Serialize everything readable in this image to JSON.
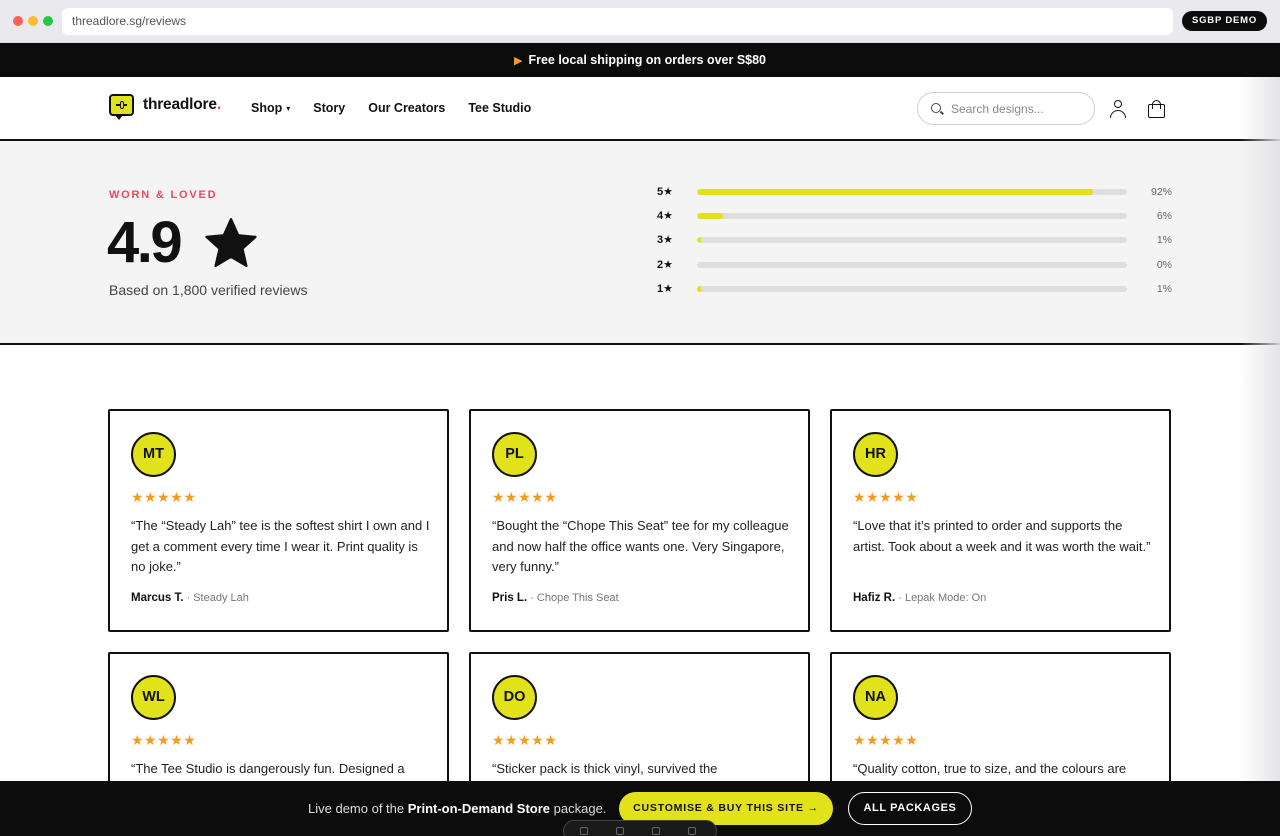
{
  "browser": {
    "url": "threadlore.sg/reviews",
    "badge": "SGBP DEMO"
  },
  "announcement": {
    "text": "Free local shipping on orders over S$80",
    "icon": "truck-icon"
  },
  "header": {
    "brand_main": "threadlore",
    "brand_dot": ".",
    "nav": {
      "shop": "Shop",
      "story": "Story",
      "creators": "Our Creators",
      "studio": "Tee Studio"
    },
    "search_placeholder": "Search designs..."
  },
  "summary": {
    "eyebrow": "WORN & LOVED",
    "score": "4.9",
    "based_on": "Based on 1,800 verified reviews",
    "distribution": [
      {
        "label": "5★",
        "percent": 92,
        "display": "92%"
      },
      {
        "label": "4★",
        "percent": 6,
        "display": "6%"
      },
      {
        "label": "3★",
        "percent": 1,
        "display": "1%"
      },
      {
        "label": "2★",
        "percent": 0,
        "display": "0%"
      },
      {
        "label": "1★",
        "percent": 1,
        "display": "1%"
      }
    ]
  },
  "reviews": [
    {
      "initials": "MT",
      "rating": 5,
      "stars": "★★★★★",
      "quote": "“The “Steady Lah” tee is the softest shirt I own and I get a comment every time I wear it. Print quality is no joke.”",
      "name": "Marcus T.",
      "product": " · Steady Lah"
    },
    {
      "initials": "PL",
      "rating": 5,
      "stars": "★★★★★",
      "quote": "“Bought the “Chope This Seat” tee for my colleague and now half the office wants one. Very Singapore, very funny.”",
      "name": "Pris L.",
      "product": " · Chope This Seat"
    },
    {
      "initials": "HR",
      "rating": 5,
      "stars": "★★★★★",
      "quote": "“Love that it’s printed to order and supports the artist. Took about a week and it was worth the wait.”",
      "name": "Hafiz R.",
      "product": " · Lepak Mode: On"
    },
    {
      "initials": "WL",
      "rating": 5,
      "stars": "★★★★★",
      "quote": "“The Tee Studio is dangerously fun. Designed a",
      "name": "",
      "product": ""
    },
    {
      "initials": "DO",
      "rating": 5,
      "stars": "★★★★★",
      "quote": "“Sticker pack is thick vinyl, survived the",
      "name": "",
      "product": ""
    },
    {
      "initials": "NA",
      "rating": 5,
      "stars": "★★★★★",
      "quote": "“Quality cotton, true to size, and the colours are",
      "name": "",
      "product": ""
    }
  ],
  "promo": {
    "prefix": "Live demo of the ",
    "package": "Print-on-Demand Store",
    "suffix": " package.",
    "cta_primary": "CUSTOMISE & BUY THIS SITE →",
    "cta_secondary": "ALL PACKAGES"
  },
  "colors": {
    "accent_yellow": "#e2e21a",
    "accent_red": "#e84a5f",
    "star_orange": "#f29b1f",
    "ink": "#111111"
  }
}
